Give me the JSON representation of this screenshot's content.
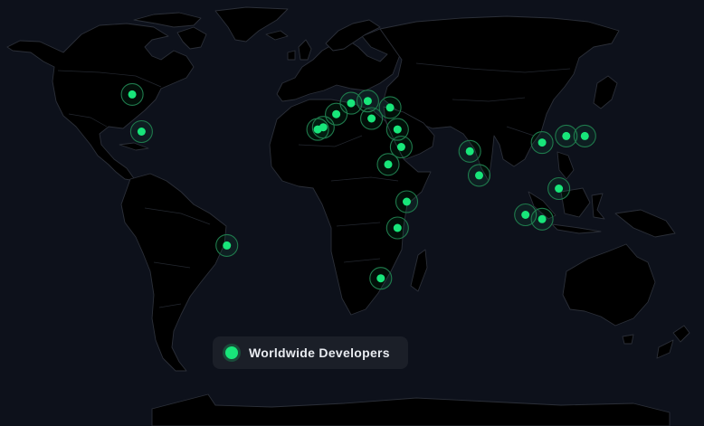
{
  "map": {
    "background": "#0d111b",
    "land_color": "#000000",
    "accent": "#18e67a",
    "projection": "equirectangular",
    "legend": {
      "label": "Worldwide Developers",
      "swatch_color": "#18e67a"
    },
    "developer_locations": [
      {
        "place": "Western Canada",
        "lon": -108,
        "lat": 55
      },
      {
        "place": "Central United States",
        "lon": -103,
        "lat": 38
      },
      {
        "place": "Brazil",
        "lon": -57,
        "lat": -14
      },
      {
        "place": "Portugal",
        "lon": -8,
        "lat": 39
      },
      {
        "place": "Spain",
        "lon": -5,
        "lat": 40
      },
      {
        "place": "France",
        "lon": 2,
        "lat": 46
      },
      {
        "place": "Germany",
        "lon": 10,
        "lat": 51
      },
      {
        "place": "Poland",
        "lon": 19,
        "lat": 52
      },
      {
        "place": "Serbia",
        "lon": 21,
        "lat": 44
      },
      {
        "place": "Ukraine",
        "lon": 31,
        "lat": 49
      },
      {
        "place": "Turkey",
        "lon": 35,
        "lat": 39
      },
      {
        "place": "Israel / Jordan",
        "lon": 37,
        "lat": 31
      },
      {
        "place": "Egypt",
        "lon": 30,
        "lat": 23
      },
      {
        "place": "Pakistan",
        "lon": 74,
        "lat": 29
      },
      {
        "place": "India",
        "lon": 79,
        "lat": 18
      },
      {
        "place": "China",
        "lon": 113,
        "lat": 33
      },
      {
        "place": "South Korea",
        "lon": 126,
        "lat": 36
      },
      {
        "place": "Japan",
        "lon": 136,
        "lat": 36
      },
      {
        "place": "Philippines",
        "lon": 122,
        "lat": 12
      },
      {
        "place": "Singapore / Sumatra",
        "lon": 104,
        "lat": 0
      },
      {
        "place": "Indonesia",
        "lon": 113,
        "lat": -2
      },
      {
        "place": "Ethiopia",
        "lon": 40,
        "lat": 6
      },
      {
        "place": "Tanzania",
        "lon": 35,
        "lat": -6
      },
      {
        "place": "South Africa",
        "lon": 26,
        "lat": -29
      }
    ]
  }
}
